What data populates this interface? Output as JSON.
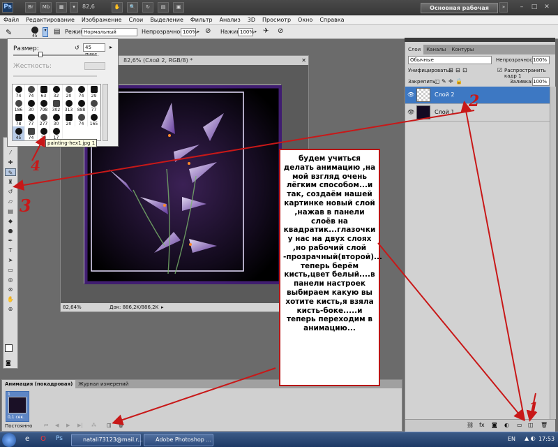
{
  "app": {
    "logo": "Ps",
    "zoom": "82,6",
    "workspace_button": "Основная рабочая среда"
  },
  "menu": [
    "Файл",
    "Редактирование",
    "Изображение",
    "Слои",
    "Выделение",
    "Фильтр",
    "Анализ",
    "3D",
    "Просмотр",
    "Окно",
    "Справка"
  ],
  "options": {
    "mode_label": "Режим:",
    "mode_value": "Нормальный",
    "opacity_label": "Непрозрачность:",
    "opacity_value": "100%",
    "flow_label": "Нажим:",
    "flow_value": "100%",
    "brush_size": "45"
  },
  "brush_panel": {
    "size_label": "Размер:",
    "size_value": "45 пикс.",
    "hardness_label": "Жесткость:",
    "brushes": [
      "74",
      "74",
      "63",
      "32",
      "20",
      "74",
      "29",
      "186",
      "30",
      "798",
      "302",
      "313",
      "888",
      "77",
      "78",
      "77",
      "277",
      "30",
      "20",
      "74",
      "165",
      "45",
      "74",
      "24",
      "17"
    ],
    "tooltip": "painting-hex1.jpg 1"
  },
  "document": {
    "title": "82,6% (Слой 2, RGB/8) *",
    "zoom_status": "82,64%",
    "doc_status": "Док: 886,2K/886,2K"
  },
  "layers_panel": {
    "tabs": [
      "Слои",
      "Каналы",
      "Контуры"
    ],
    "blend_mode": "Обычные",
    "opacity_label": "Непрозрачность:",
    "opacity_value": "100%",
    "unify_label": "Унифицировать:",
    "propagate_label": "Распространить кадр 1",
    "lock_label": "Закрепить:",
    "fill_label": "Заливка:",
    "fill_value": "100%",
    "layers": [
      {
        "name": "Слой 2",
        "selected": true
      },
      {
        "name": "Слой 1",
        "selected": false
      }
    ],
    "bottom_icons": [
      "link-icon",
      "fx-icon",
      "mask-icon",
      "adjustment-icon",
      "folder-icon",
      "new-layer-icon",
      "trash-icon"
    ]
  },
  "animation_panel": {
    "tabs": [
      "Анимация (покадровая)",
      "Журнал измерений"
    ],
    "frame_number": "1",
    "frame_delay": "0,1 сек.",
    "loop": "Постоянно"
  },
  "annotation": {
    "text": "будем учиться делать анимацию ,на мой взгляд очень лёгким способом...и так, создаём нашей картинке новый слой ,нажав в панели слоёв на квадратик...глазочки у нас на двух слоях ,но рабочий слой -прозрачный(второй)... теперь берём кисть,цвет белый....в панели настроек выбираем какую вы хотите кисть,я взяла кисть-боке.....и теперь переходим в анимацию...",
    "numbers": [
      "1",
      "2",
      "3",
      "4"
    ],
    "color": "#c81818"
  },
  "taskbar": {
    "items": [
      "natali73123@mail.r...",
      "Adobe Photoshop ..."
    ],
    "lang": "EN",
    "time": "17:53"
  }
}
